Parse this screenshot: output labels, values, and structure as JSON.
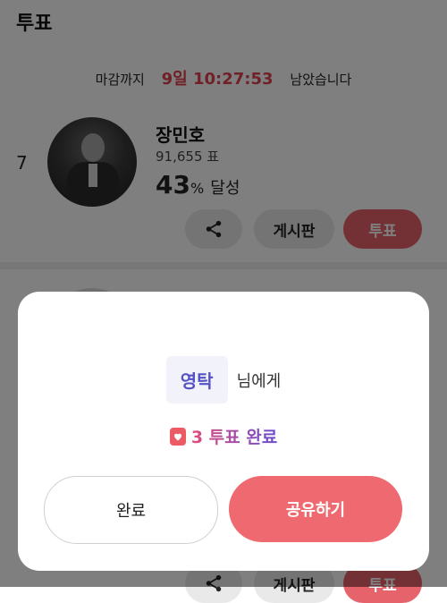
{
  "header": {
    "title": "투표"
  },
  "deadline": {
    "prefix": "마감까지",
    "time": "9일 10:27:53",
    "suffix": "남았습니다"
  },
  "candidate": {
    "rank": "7",
    "name": "장민호",
    "votes": "91,655 표",
    "percent": "43",
    "percent_sign": "%",
    "achieve_label": "달성"
  },
  "actions": {
    "board_label": "게시판",
    "vote_label": "투표"
  },
  "modal": {
    "recipient": "영탁",
    "recipient_suffix": "님에게",
    "complete_text": "3 투표 완료",
    "done_label": "완료",
    "share_label": "공유하기"
  },
  "colors": {
    "accent": "#e7636b",
    "primary_purple": "#5552c4"
  }
}
